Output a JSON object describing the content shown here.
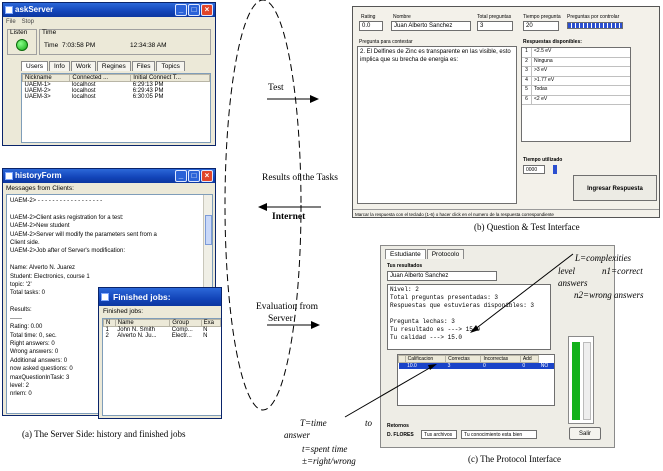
{
  "server_window": {
    "title": "askServer",
    "menu": [
      "File",
      "Stop"
    ],
    "listen_label": "Listen",
    "time_label": "Time",
    "time_field_label": "Time",
    "time_value_1": "7:03:58 PM",
    "time_value_2": "12:34:38 AM",
    "tabs": [
      "Users",
      "Info",
      "Work",
      "Regines",
      "Files",
      "Topics"
    ],
    "columns": [
      "Nickname",
      "Connected ...",
      "Initial Connect T..."
    ],
    "rows": [
      [
        "UAEM-1>",
        "localhost",
        "6:29:13 PM"
      ],
      [
        "UAEM-2>",
        "localhost",
        "6:29:43 PM"
      ],
      [
        "UAEM-3>",
        "localhost",
        "6:30:05 PM"
      ]
    ]
  },
  "history_window": {
    "title": "historyForm",
    "header": "Messages from Clients:",
    "messages": [
      "UAEM-2> - - - - - - - - - - - - - - - - - -",
      "",
      "UAEM-2>Client asks registration for a test:",
      "UAEM-2>New student",
      "UAEM-2>Server will modify the parameters sent from a",
      "Client side.",
      "UAEM-2>Job after of Server's modification:",
      "",
      "Name: Alverto N. Juarez",
      "Student: Electronics, course 1",
      "topic: '2'",
      "Total tasks:        0",
      "",
      "Results:",
      "------",
      "Rating:             0.00",
      "Total time:         0, sec.",
      "Right answers:      0",
      "Wrong answers:      0",
      "Additional answers: 0",
      "now asked questions: 0",
      "maxQuestionInTask:  3",
      "level:              2",
      "nrlem:              0"
    ]
  },
  "finished_window": {
    "title": "Finished jobs:",
    "header": "Finished jobs:",
    "columns": [
      "N",
      "Name",
      "Group",
      "Exa"
    ],
    "rows": [
      [
        "1",
        "John N. Smith",
        "Comp...",
        "N"
      ],
      [
        "2",
        "Alverto N. Ju...",
        "Electr...",
        "N"
      ]
    ]
  },
  "question_window": {
    "rating_label": "Rating",
    "rating_value": "0.0",
    "name_label": "Nombre",
    "name_value": "Juan Alberto Sanchez",
    "total_label": "Total preguntas",
    "total_value": "3",
    "time_label": "Tiempo pregunta",
    "time_value": "20",
    "controller_label": "Preguntas por controlar",
    "question_label": "Pregunta para contestar",
    "question_text": "2. El Delfines de Zinc es transparente en las visible, esto implica que su brecha de energia es:",
    "answers_label": "Respuestas disponibles:",
    "answers": [
      [
        "1",
        "<2.5 eV"
      ],
      [
        "2",
        "Ninguna"
      ],
      [
        "3",
        ">3 eV"
      ],
      [
        "4",
        ">1.77 eV"
      ],
      [
        "5",
        "Todas"
      ],
      [
        "6",
        "<2 eV"
      ]
    ],
    "elapsed_label": "Tiempo utilizado",
    "elapsed_value": "0000",
    "submit_label": "Ingresar Respuesta",
    "status_text": "Marcar la respuesta con el teclado (1-6) o hacer click en el numero de la respuesta correspondiente"
  },
  "protocol_window": {
    "tabs": [
      "Estudiante",
      "Protocolo"
    ],
    "results_label": "Tus resultados",
    "name_value": "Juan Alberto Sanchez",
    "code_lines": [
      "Nivel: 2",
      "Total preguntas presentadas: 3",
      "Respuestas que estuvieras disponibles: 3",
      "",
      "Pregunta lechas: 3",
      "Tu resultado es ---> 15.0",
      "Tu calidad ---> 15.0"
    ],
    "table_columns": [
      "",
      "Calificacion",
      "Correctas",
      "Incorrectas",
      "Add"
    ],
    "table_rows": [
      [
        "",
        "10.0",
        "3",
        "0",
        "0",
        "NO"
      ]
    ],
    "bottom_label": "Retornos",
    "bottom_name": "D. FLORES",
    "bottom_field_1": "Tus archivos",
    "bottom_field_2": "Tu conocimiento esta bien",
    "exit_button": "Salir"
  },
  "diagram": {
    "test_label": "Test",
    "results_label": "Results of the Tasks",
    "internet_label": "Internet",
    "evaluation_label_1": "Evaluation from",
    "evaluation_label_2": "Server"
  },
  "annotations": {
    "complexity_1": "L=complexities",
    "complexity_2a": "level",
    "complexity_2b": "n1=correct",
    "complexity_3": "answers",
    "complexity_4": "n2=wrong answers",
    "time_1a": "T=time",
    "time_1b": "to",
    "time_2": "answer",
    "time_3": "t=spent time",
    "time_4": "±=right/wrong"
  },
  "captions": {
    "server": "(a) The Server Side: history and finished jobs",
    "question": "(b) Question & Test Interface",
    "protocol": "(c) The Protocol Interface"
  }
}
